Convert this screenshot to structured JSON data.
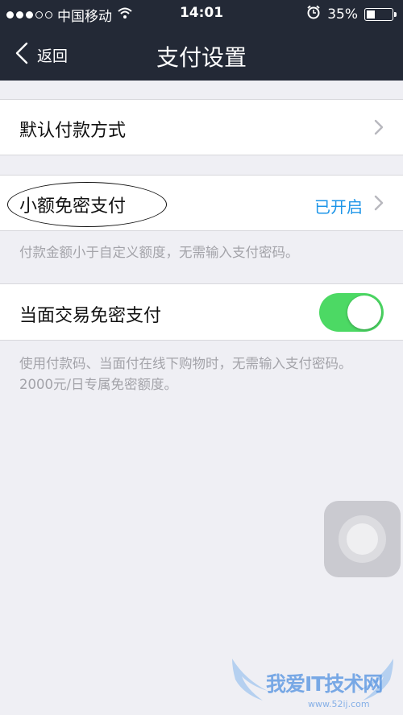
{
  "status_bar": {
    "carrier": "中国移动",
    "time": "14:01",
    "battery_percent": "35%",
    "battery_level": 0.35,
    "signal_bars_filled": 3,
    "signal_bars_total": 5
  },
  "nav": {
    "back_label": "返回",
    "title": "支付设置"
  },
  "settings": {
    "default_payment": {
      "label": "默认付款方式"
    },
    "small_amount": {
      "label": "小额免密支付",
      "value": "已开启",
      "note": "付款金额小于自定义额度，无需输入支付密码。"
    },
    "face_to_face": {
      "label": "当面交易免密支付",
      "enabled": true,
      "note": "使用付款码、当面付在线下购物时，无需输入支付密码。2000元/日专属免密额度。"
    }
  },
  "watermark": {
    "text": "我爱IT技术网",
    "url": "www.52ij.com"
  },
  "colors": {
    "nav_background": "#232936",
    "page_background": "#efeff4",
    "accent_blue": "#1d95e8",
    "toggle_on": "#4cd964",
    "note_gray": "#a3a3a9"
  }
}
